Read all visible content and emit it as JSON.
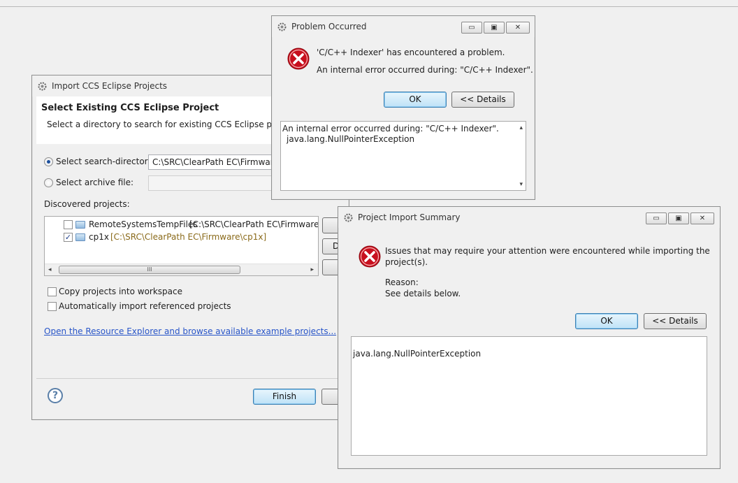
{
  "colors": {
    "accent": "#3c7fb1",
    "link": "#2855c8",
    "error": "#c8101e",
    "path_text": "#8a6a1a"
  },
  "import_dialog": {
    "title": "Import CCS Eclipse Projects",
    "heading": "Select Existing CCS Eclipse Project",
    "description": "Select a directory to search for existing CCS Eclipse projects.",
    "search_dir_label": "Select search-directory:",
    "search_dir_value": "C:\\SRC\\ClearPath EC\\Firmware",
    "archive_label": "Select archive file:",
    "archive_value": "",
    "discovered_label": "Discovered projects:",
    "projects": [
      {
        "name": "RemoteSystemsTempFiles",
        "path": "[C:\\SRC\\ClearPath EC\\Firmware\\Re",
        "checked": false
      },
      {
        "name": "cp1x",
        "path": "[C:\\SRC\\ClearPath EC\\Firmware\\cp1x]",
        "checked": true
      }
    ],
    "side_button_2": "D",
    "scroll_thumb": "III",
    "copy_label": "Copy projects into workspace",
    "auto_import_label": "Automatically import referenced projects",
    "resource_link": "Open the Resource Explorer and browse available example projects...",
    "help_icon": "?",
    "finish_label": "Finish"
  },
  "problem_dialog": {
    "title": "Problem Occurred",
    "message1": "'C/C++ Indexer' has encountered a problem.",
    "message2": "An internal error occurred during: \"C/C++ Indexer\".",
    "ok_label": "OK",
    "details_label": "<< Details",
    "details_line1": "An internal error occurred during: \"C/C++ Indexer\".",
    "details_line2": "java.lang.NullPointerException"
  },
  "summary_dialog": {
    "title": "Project Import Summary",
    "message_line1": "Issues that may require your attention were encountered while importing the",
    "message_line2": "project(s).",
    "reason_label": "Reason:",
    "reason_value": "See details below.",
    "ok_label": "OK",
    "details_label": "<< Details",
    "details_text": "java.lang.NullPointerException"
  },
  "window_controls": {
    "minimize": "▭",
    "maximize": "▣",
    "close": "✕"
  },
  "icons": {
    "title": "eclipse-gear-icon",
    "error": "error-x-icon",
    "folder": "project-folder-icon",
    "check": "✓"
  }
}
